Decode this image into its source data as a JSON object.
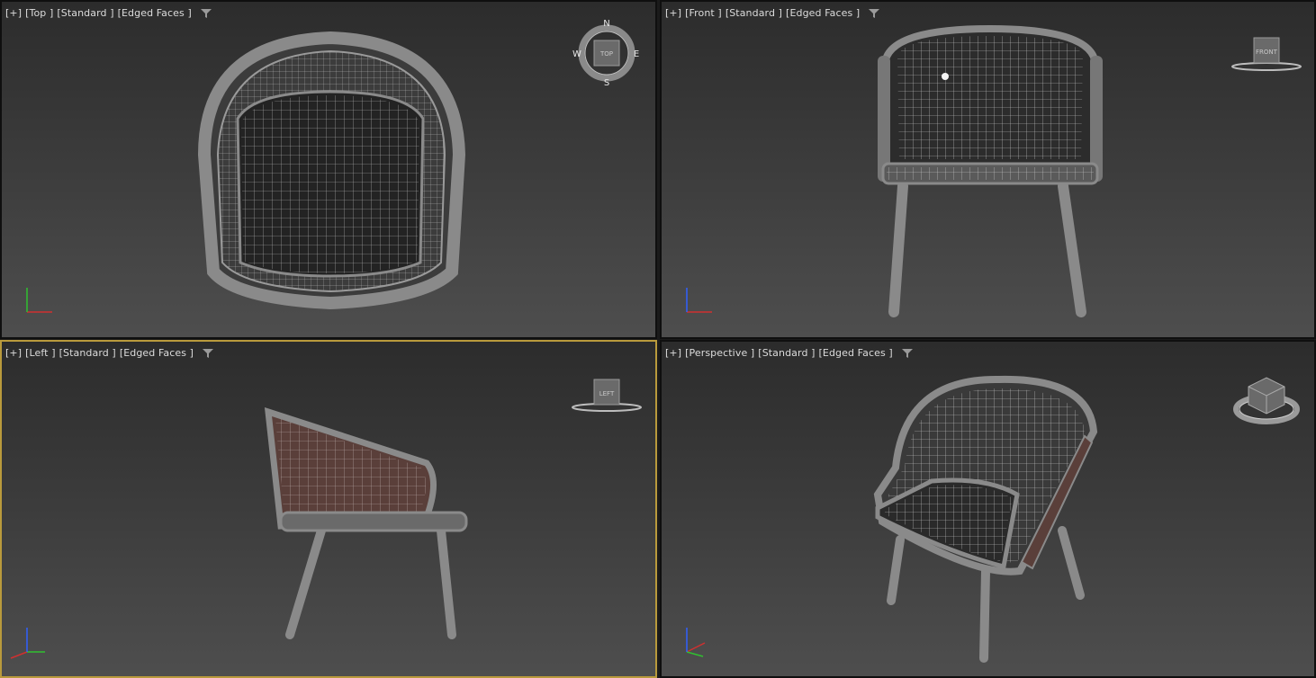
{
  "viewports": {
    "top": {
      "plus": "[+]",
      "view": "[Top ]",
      "shading": "[Standard ]",
      "edges": "[Edged Faces ]",
      "cube_label": "TOP",
      "active": false
    },
    "front": {
      "plus": "[+]",
      "view": "[Front ]",
      "shading": "[Standard ]",
      "edges": "[Edged Faces ]",
      "cube_label": "FRONT",
      "active": false
    },
    "left": {
      "plus": "[+]",
      "view": "[Left ]",
      "shading": "[Standard ]",
      "edges": "[Edged Faces ]",
      "cube_label": "LEFT",
      "active": true
    },
    "persp": {
      "plus": "[+]",
      "view": "[Perspective ]",
      "shading": "[Standard ]",
      "edges": "[Edged Faces ]",
      "cube_label": "",
      "active": false
    }
  },
  "compass": {
    "n": "N",
    "s": "S",
    "e": "E",
    "w": "W"
  },
  "axes": {
    "x": "x",
    "y": "y",
    "z": "z"
  },
  "colors": {
    "active_border": "#b99a3c",
    "wire": "#8a8a8a",
    "wire_dark": "#1a1a1a",
    "fabric": "#5a3f3a",
    "axis_x": "#d03030",
    "axis_y": "#30c030",
    "axis_z": "#3060ff"
  },
  "icons": {
    "filter": "filter-icon",
    "viewcube": "viewcube-icon",
    "axis_tripod": "axis-tripod-icon",
    "compass": "compass-icon"
  }
}
